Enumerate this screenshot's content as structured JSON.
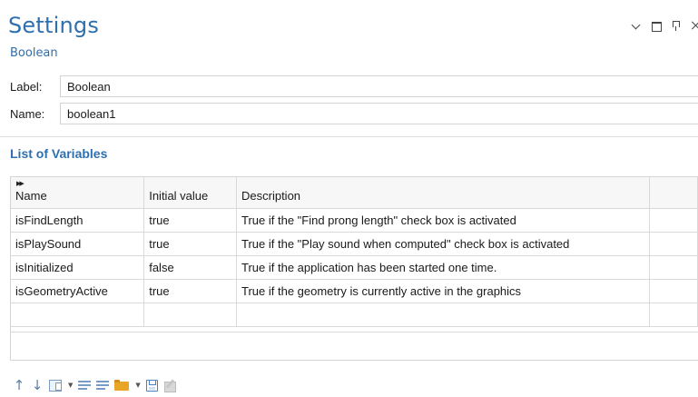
{
  "window": {
    "title": "Settings",
    "subtitle": "Boolean",
    "controls": [
      "chevron-down-icon",
      "maximize-icon",
      "pin-icon",
      "close-icon"
    ]
  },
  "fields": {
    "label": {
      "caption": "Label:",
      "value": "Boolean"
    },
    "name": {
      "caption": "Name:",
      "value": "boolean1"
    }
  },
  "section": {
    "title": "List of Variables"
  },
  "table": {
    "columns": [
      "Name",
      "Initial value",
      "Description"
    ],
    "rows": [
      {
        "name": "isFindLength",
        "initial": "true",
        "description": "True if the \"Find prong length\" check box is activated"
      },
      {
        "name": "isPlaySound",
        "initial": "true",
        "description": "True if the \"Play sound when computed\" check box is activated"
      },
      {
        "name": "isInitialized",
        "initial": "false",
        "description": "True if the application has been started one time."
      },
      {
        "name": "isGeometryActive",
        "initial": "true",
        "description": "True if the geometry is currently active in the graphics"
      },
      {
        "name": "",
        "initial": "",
        "description": ""
      }
    ]
  },
  "toolbar": {
    "icons": [
      "move-up-icon",
      "move-down-icon",
      "insert-row-icon",
      "list-icon",
      "clear-list-icon",
      "open-folder-icon",
      "save-icon",
      "edit-icon"
    ]
  },
  "colors": {
    "accent": "#2e6fae",
    "border": "#d4d4d4"
  }
}
